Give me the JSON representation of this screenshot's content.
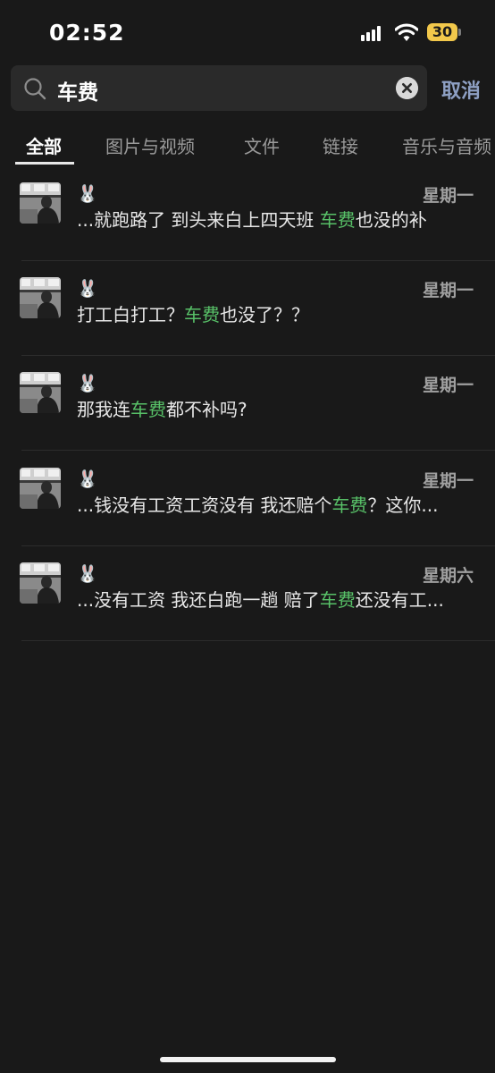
{
  "status_bar": {
    "time": "02:52",
    "battery_level": "30",
    "signal_icon": "cellular-signal-icon",
    "wifi_icon": "wifi-icon"
  },
  "search": {
    "query": "车费",
    "cancel_label": "取消",
    "search_icon": "search-icon",
    "clear_icon": "clear-icon"
  },
  "tabs": [
    {
      "label": "全部",
      "active": true
    },
    {
      "label": "图片与视频",
      "active": false
    },
    {
      "label": "文件",
      "active": false
    },
    {
      "label": "链接",
      "active": false
    },
    {
      "label": "音乐与音频",
      "active": false
    }
  ],
  "highlight_color": "#58c168",
  "results": [
    {
      "name": "🐰",
      "date": "星期一",
      "before": "...就跑路了 到头来白上四天班 ",
      "keyword": "车费",
      "after": "也没的补"
    },
    {
      "name": "🐰",
      "date": "星期一",
      "before": "打工白打工？",
      "keyword": "车费",
      "after": "也没了？？"
    },
    {
      "name": "🐰",
      "date": "星期一",
      "before": "那我连",
      "keyword": "车费",
      "after": "都不补吗?"
    },
    {
      "name": "🐰",
      "date": "星期一",
      "before": "...钱没有工资工资没有 我还赔个",
      "keyword": "车费",
      "after": "？这你..."
    },
    {
      "name": "🐰",
      "date": "星期六",
      "before": "...没有工资 我还白跑一趟 赔了",
      "keyword": "车费",
      "after": "还没有工..."
    }
  ]
}
